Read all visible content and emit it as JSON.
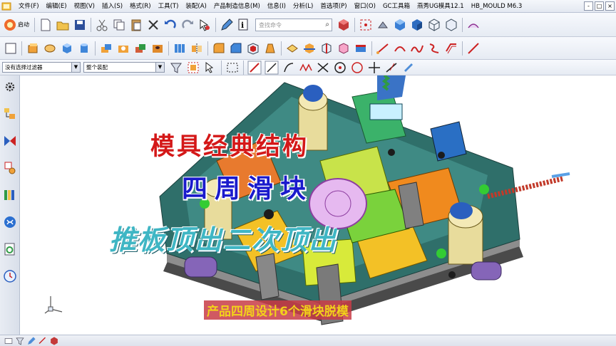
{
  "app": {
    "menus": [
      "文件(F)",
      "编辑(E)",
      "视图(V)",
      "插入(S)",
      "格式(R)",
      "工具(T)",
      "装配(A)",
      "产品制造信息(M)",
      "信息(I)",
      "分析(L)",
      "首选项(P)",
      "窗口(O)",
      "GC工具箱",
      "燕秀UG模具12.1",
      "HB_MOULD M6.3"
    ],
    "window_controls": [
      "-",
      "□",
      "×"
    ]
  },
  "toolbar1": {
    "start_label": "启动",
    "search_placeholder": "查找命令"
  },
  "toolbar3": {
    "filter_select": "没有选择过滤器",
    "assembly_select": "整个装配"
  },
  "overlay": {
    "title_line1": "模具经典结构",
    "title_line2": "四周滑块",
    "title_line3": "推板顶出二次顶出",
    "caption": "产品四周设计6个滑块脱模"
  },
  "colors": {
    "title_red": "#d41818",
    "title_blue": "#1a1acc",
    "title_teal": "#3fb6c4",
    "caption_bg": "#c83c46",
    "caption_text": "#f2d21a"
  }
}
